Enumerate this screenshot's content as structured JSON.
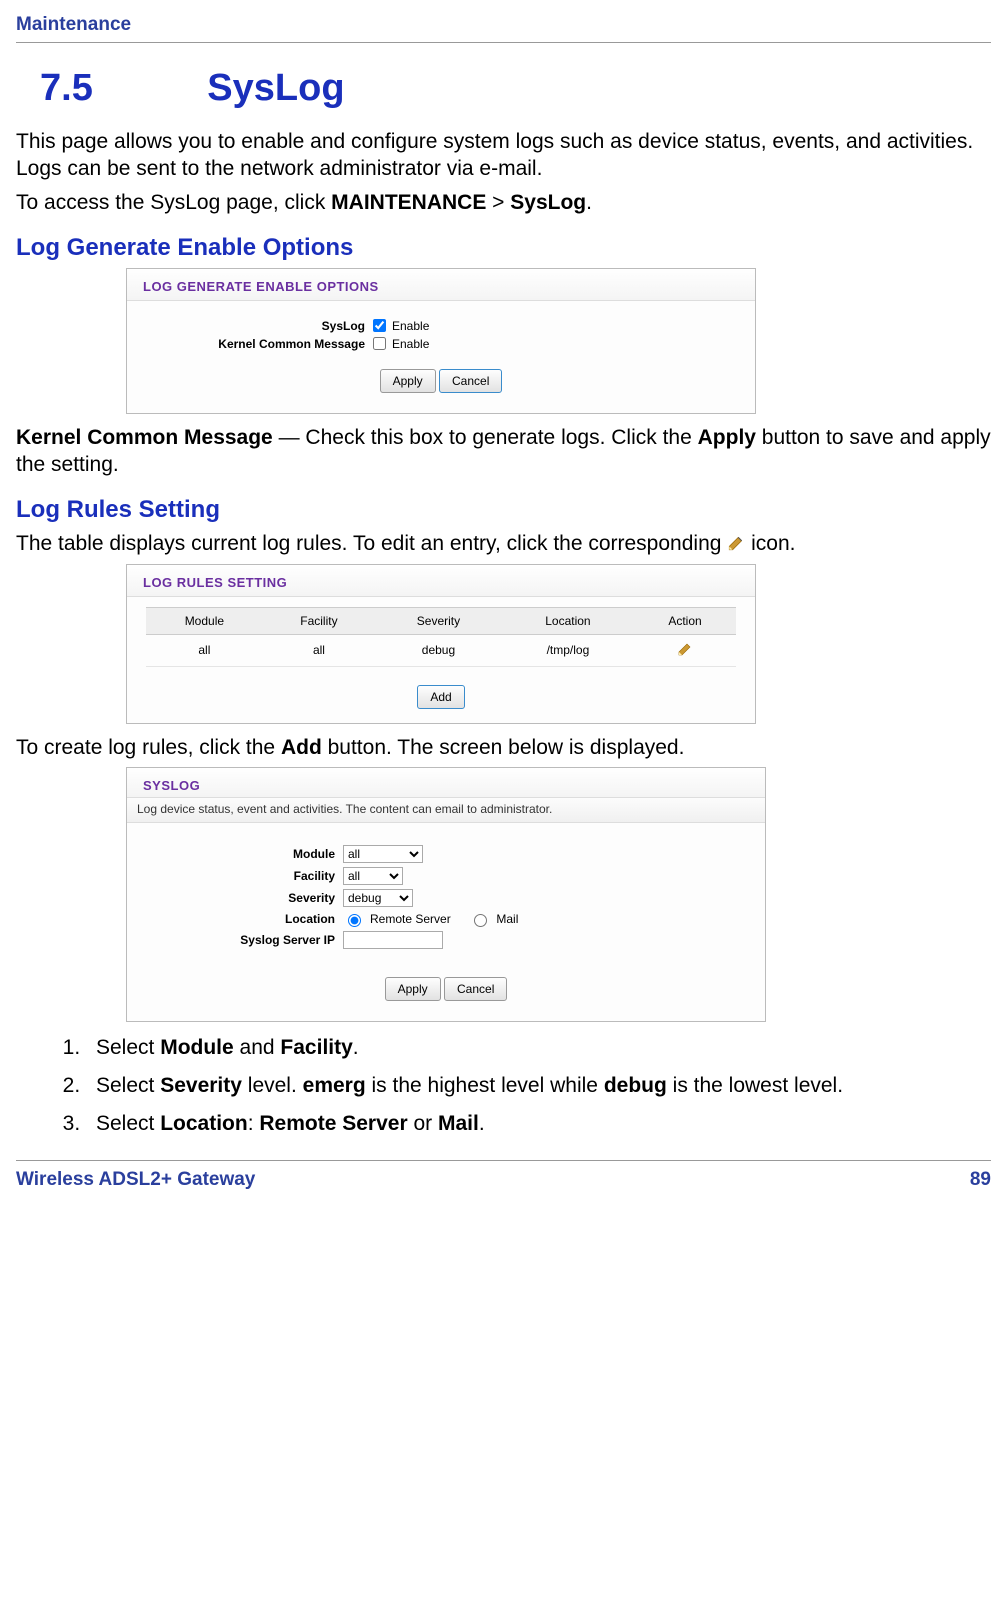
{
  "header": {
    "chapter": "Maintenance"
  },
  "title": {
    "number": "7.5",
    "name": "SysLog"
  },
  "intro1": "This page allows you to enable and configure system logs such as device status, events, and activities. Logs can be sent to the network administrator via e-mail.",
  "intro2_pre": "To access the SysLog page, click ",
  "intro2_b1": "MAINTENANCE",
  "intro2_mid": " > ",
  "intro2_b2": "SysLog",
  "intro2_post": ".",
  "h1": "Log Generate Enable Options",
  "panel1": {
    "header": "LOG GENERATE ENABLE OPTIONS",
    "row1_label": "SysLog",
    "row1_enable": "Enable",
    "row2_label": "Kernel Common Message",
    "row2_enable": "Enable",
    "apply": "Apply",
    "cancel": "Cancel"
  },
  "para2_b": "Kernel Common Message",
  "para2_rest1": " — Check this box to generate logs. Click the ",
  "para2_apply": "Apply",
  "para2_rest2": " button to save and apply the setting.",
  "h2": "Log Rules Setting",
  "para3_pre": "The table displays current log rules. To edit an entry, click the corresponding ",
  "para3_post": " icon.",
  "panel2": {
    "header": "LOG RULES SETTING",
    "col1": "Module",
    "col2": "Facility",
    "col3": "Severity",
    "col4": "Location",
    "col5": "Action",
    "r1c1": "all",
    "r1c2": "all",
    "r1c3": "debug",
    "r1c4": "/tmp/log",
    "add": "Add"
  },
  "para4_pre": "To create log rules, click the ",
  "para4_add": "Add",
  "para4_post": " button. The screen below is displayed.",
  "panel3": {
    "header": "SYSLOG",
    "caption": "Log device status, event and activities. The content can email to administrator.",
    "module_label": "Module",
    "module_val": "all",
    "facility_label": "Facility",
    "facility_val": "all",
    "severity_label": "Severity",
    "severity_val": "debug",
    "location_label": "Location",
    "loc_remote": "Remote Server",
    "loc_mail": "Mail",
    "serverip_label": "Syslog Server IP",
    "serverip_val": "",
    "apply": "Apply",
    "cancel": "Cancel"
  },
  "steps": {
    "s1_pre": "Select ",
    "s1_b1": "Module",
    "s1_mid": " and ",
    "s1_b2": "Facility",
    "s1_post": ".",
    "s2_pre": "Select ",
    "s2_b1": "Severity",
    "s2_mid": " level. ",
    "s2_b2": "emerg",
    "s2_mid2": " is the highest level while ",
    "s2_b3": "debug",
    "s2_post": " is the lowest level.",
    "s3_pre": "Select ",
    "s3_b1": "Location",
    "s3_mid": ": ",
    "s3_b2": "Remote Server",
    "s3_mid2": " or ",
    "s3_b3": "Mail",
    "s3_post": "."
  },
  "footer": {
    "product": "Wireless ADSL2+ Gateway",
    "page": "89"
  }
}
